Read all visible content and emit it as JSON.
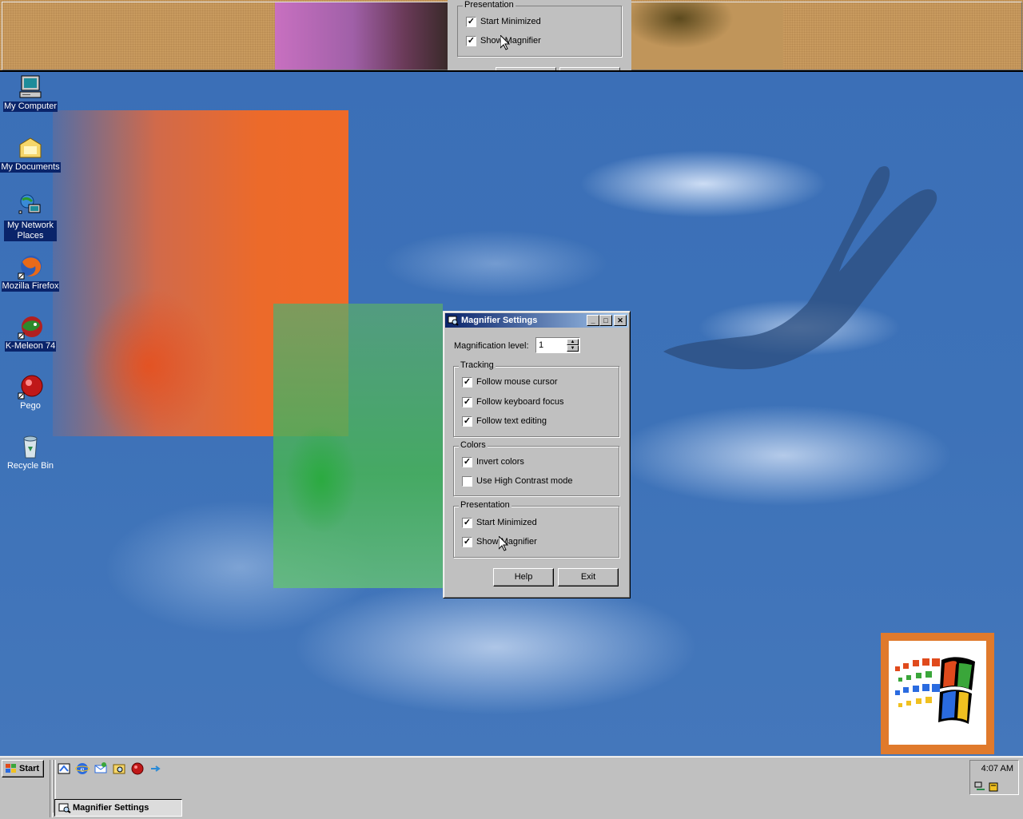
{
  "magnifier_view": {
    "group_legend": "Presentation",
    "items": [
      {
        "label": "Start Minimized",
        "checked": true
      },
      {
        "label": "Show Magnifier",
        "checked": true
      }
    ]
  },
  "desktop_icons": [
    {
      "label": "My Computer",
      "icon": "my-computer-icon",
      "selected": true
    },
    {
      "label": "My Documents",
      "icon": "folder-icon",
      "selected": true
    },
    {
      "label": "My Network Places",
      "icon": "network-icon",
      "selected": true
    },
    {
      "label": "Mozilla Firefox",
      "icon": "firefox-icon",
      "selected": true
    },
    {
      "label": "K-Meleon 74",
      "icon": "kmeleon-icon",
      "selected": true
    },
    {
      "label": "Pego",
      "icon": "pego-icon",
      "selected": false
    },
    {
      "label": "Recycle Bin",
      "icon": "recycle-bin-icon",
      "selected": false
    }
  ],
  "window": {
    "title": "Magnifier Settings",
    "minimize": "_",
    "maximize": "□",
    "close": "✕",
    "magnification_label": "Magnification level:",
    "magnification_value": "1",
    "tracking": {
      "legend": "Tracking",
      "items": [
        {
          "label": "Follow mouse cursor",
          "checked": true
        },
        {
          "label": "Follow keyboard focus",
          "checked": true
        },
        {
          "label": "Follow text editing",
          "checked": true
        }
      ]
    },
    "colors": {
      "legend": "Colors",
      "items": [
        {
          "label": "Invert colors",
          "checked": true
        },
        {
          "label": "Use High Contrast mode",
          "checked": false
        }
      ]
    },
    "presentation": {
      "legend": "Presentation",
      "items": [
        {
          "label": "Start Minimized",
          "checked": true
        },
        {
          "label": "Show Magnifier",
          "checked": true
        }
      ]
    },
    "help_label": "Help",
    "exit_label": "Exit"
  },
  "taskbar": {
    "start_label": "Start",
    "task_label": "Magnifier Settings",
    "clock": "4:07 AM",
    "quick_launch": [
      "show-desktop-icon",
      "internet-explorer-icon",
      "outlook-express-icon",
      "windows-explorer-icon",
      "pego-icon",
      "arrow-icon"
    ]
  },
  "colors": {
    "titlebar_start": "#0a246a",
    "titlebar_end": "#a6caf0",
    "face": "#c0c0c0",
    "desktop": "#3a6fb3"
  }
}
